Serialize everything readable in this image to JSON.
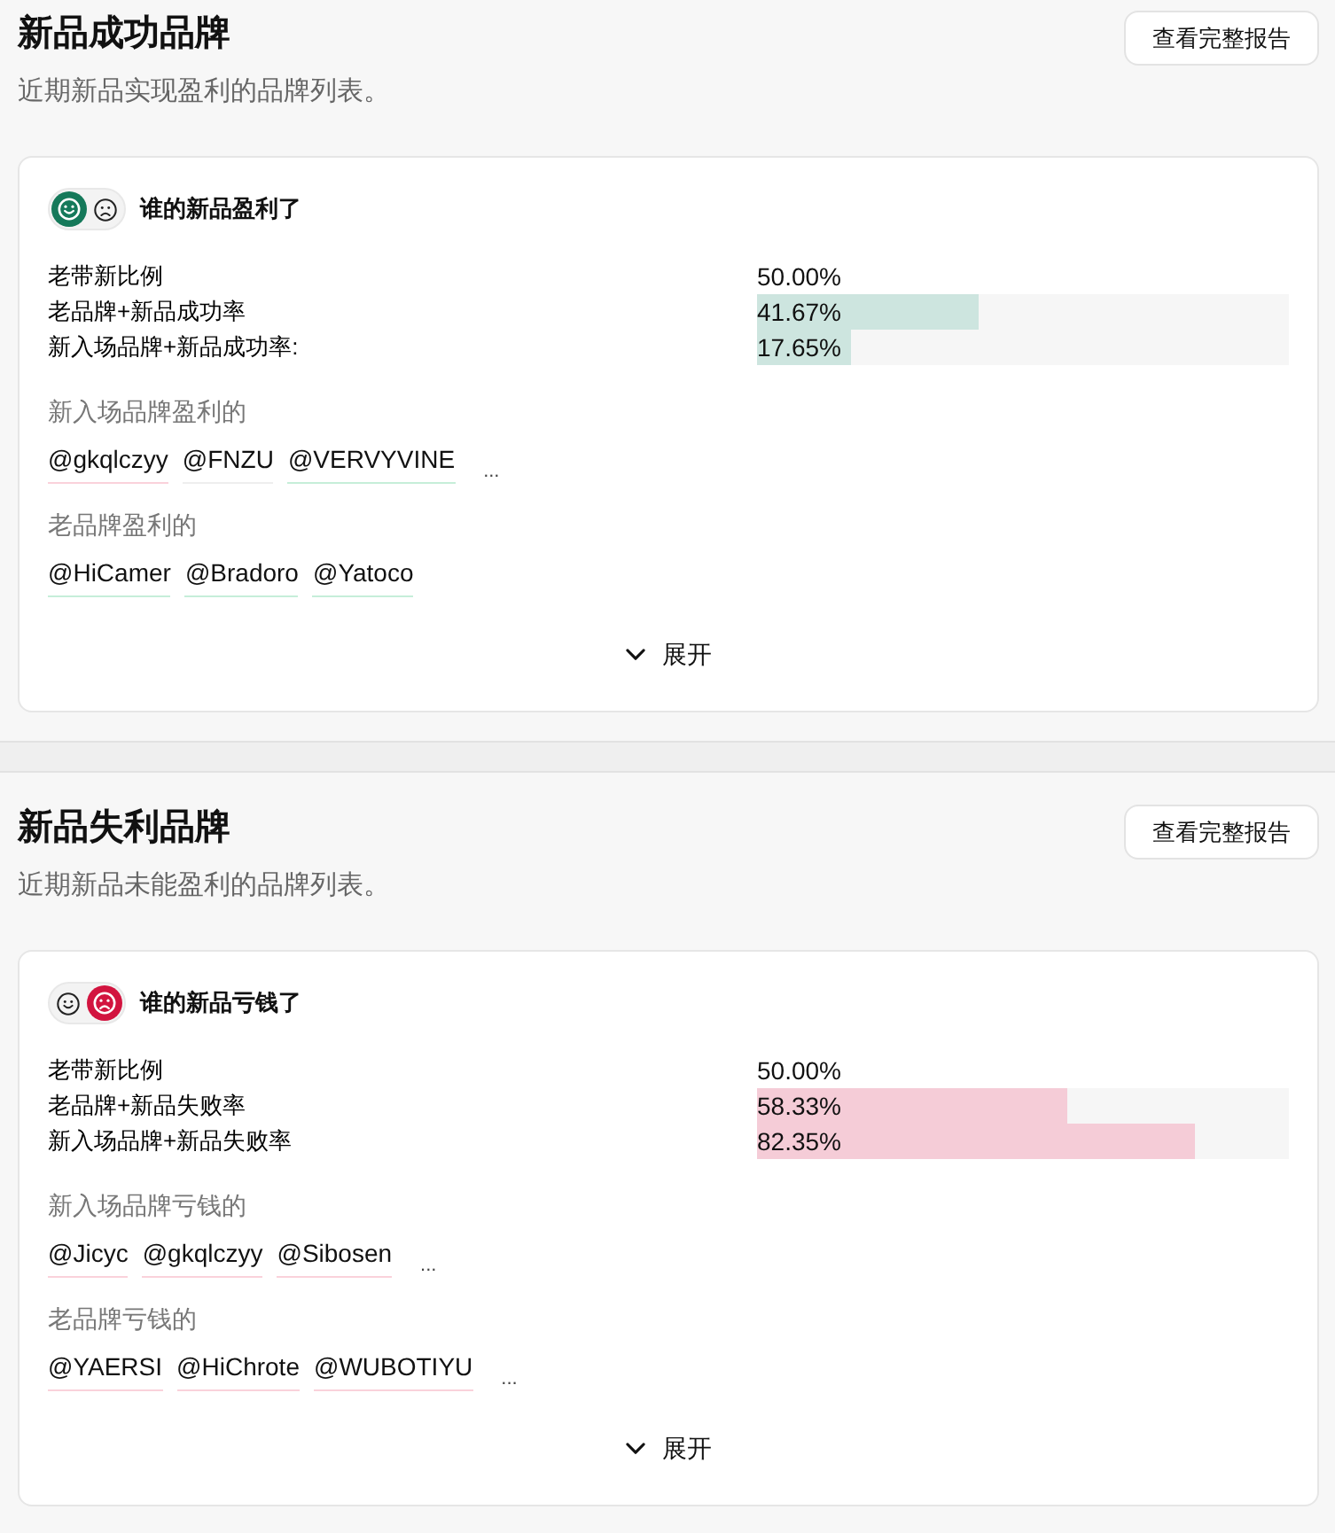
{
  "sections": [
    {
      "title": "新品成功品牌",
      "subtitle": "近期新品实现盈利的品牌列表。",
      "report_button": "查看完整报告",
      "card": {
        "kind": "profit",
        "faces": [
          {
            "kind": "smile",
            "selected": true
          },
          {
            "kind": "frown",
            "selected": false
          }
        ],
        "heading": "谁的新品盈利了",
        "metrics": [
          {
            "kind": "plain",
            "label": "老带新比例",
            "value": "50.00%"
          },
          {
            "kind": "bar",
            "label": "老品牌+新品成功率",
            "value": "41.67%",
            "level": 0.4167
          },
          {
            "kind": "bar",
            "label": "新入场品牌+新品成功率:",
            "value": "17.65%",
            "level": 0.1765
          }
        ],
        "groups": [
          {
            "label": "新入场品牌盈利的",
            "tags": [
              {
                "text": "@gkqlczyy",
                "color": "#fad2db"
              },
              {
                "text": "@FNZU",
                "color": "#eeeeee"
              },
              {
                "text": "@VERVYVINE",
                "color": "#c6eed9"
              }
            ],
            "more": "..."
          },
          {
            "label": "老品牌盈利的",
            "tags": [
              {
                "text": "@HiCamer",
                "color": "#c6eed9"
              },
              {
                "text": "@Bradoro",
                "color": "#c6eed9"
              },
              {
                "text": "@Yatoco",
                "color": "#c6eed9"
              }
            ]
          }
        ],
        "expand_button": "展开"
      }
    },
    {
      "title": "新品失利品牌",
      "subtitle": "近期新品未能盈利的品牌列表。",
      "report_button": "查看完整报告",
      "card": {
        "kind": "loss",
        "faces": [
          {
            "kind": "smile",
            "selected": false
          },
          {
            "kind": "frown",
            "selected": true
          }
        ],
        "heading": "谁的新品亏钱了",
        "metrics": [
          {
            "kind": "plain",
            "label": "老带新比例",
            "value": "50.00%"
          },
          {
            "kind": "bar",
            "label": "老品牌+新品失败率",
            "value": "58.33%",
            "level": 0.5833
          },
          {
            "kind": "bar",
            "label": "新入场品牌+新品失败率",
            "value": "82.35%",
            "level": 0.8235
          }
        ],
        "groups": [
          {
            "label": "新入场品牌亏钱的",
            "tags": [
              {
                "text": "@Jicyc",
                "color": "#fad2db"
              },
              {
                "text": "@gkqlczyy",
                "color": "#fad2db"
              },
              {
                "text": "@Sibosen",
                "color": "#fad2db"
              }
            ],
            "more": "..."
          },
          {
            "label": "老品牌亏钱的",
            "tags": [
              {
                "text": "@YAERSI",
                "color": "#fad2db"
              },
              {
                "text": "@HiChrote",
                "color": "#fad2db"
              },
              {
                "text": "@WUBOTIYU",
                "color": "#fad2db"
              }
            ],
            "more": "..."
          }
        ],
        "expand_button": "展开"
      }
    }
  ]
}
